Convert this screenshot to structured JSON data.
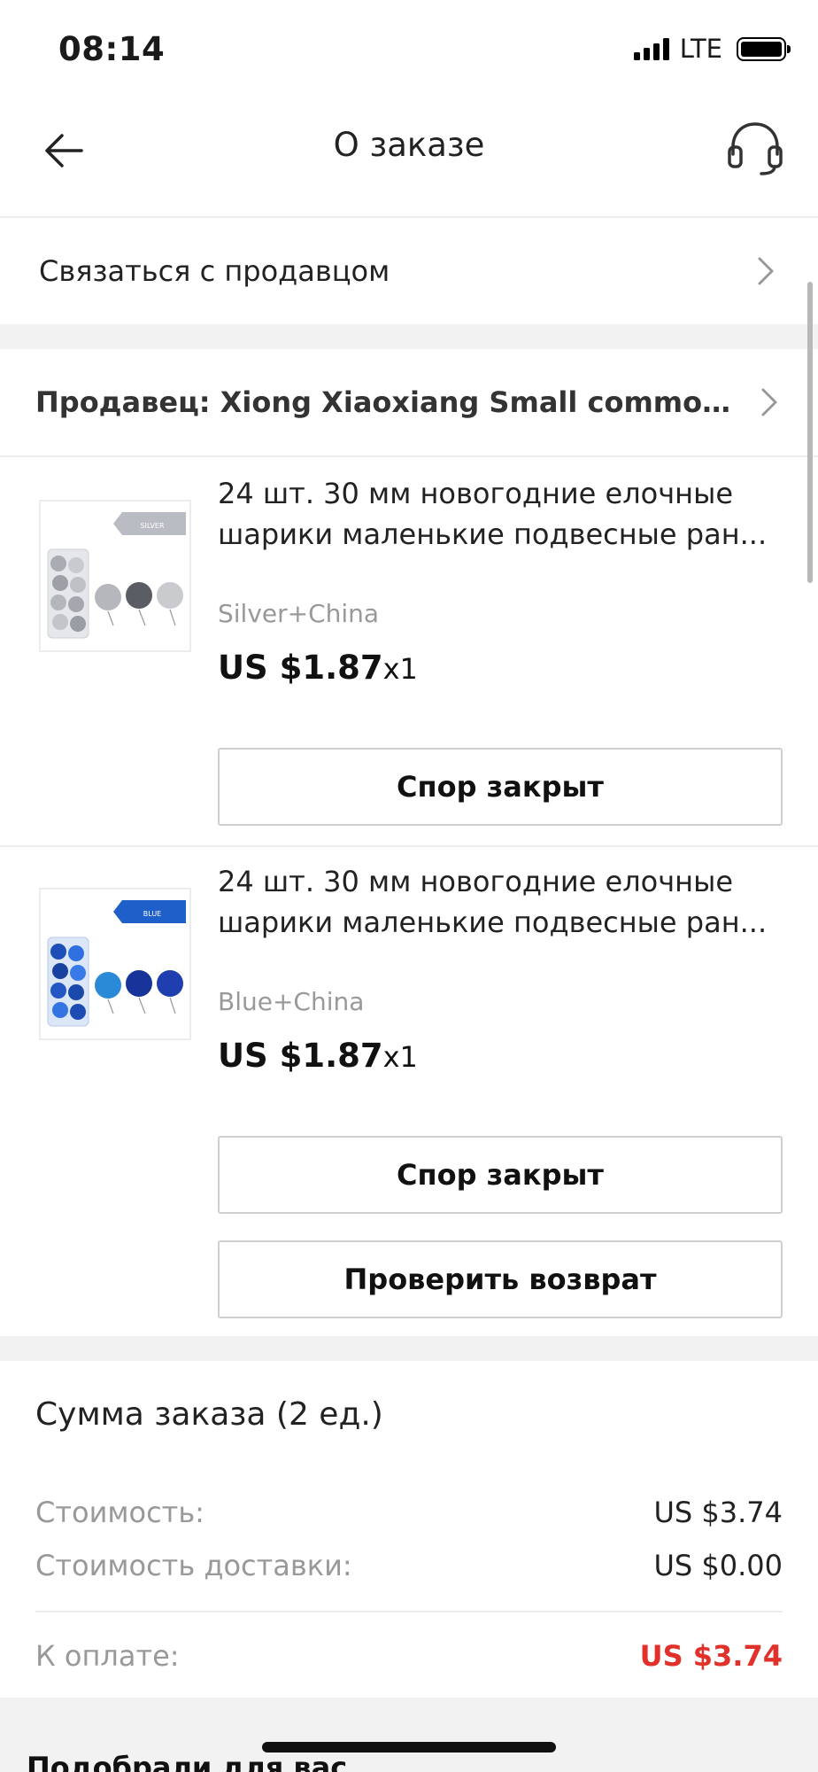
{
  "status_bar": {
    "time": "08:14",
    "network": "LTE"
  },
  "header": {
    "title": "О заказе"
  },
  "contact_seller": {
    "label": "Связаться с продавцом"
  },
  "seller": {
    "label": "Продавец: Xiong Xiaoxiang Small commoditi..."
  },
  "items": [
    {
      "title_line1": "24 шт. 30 мм новогодние елочные",
      "title_line2": "шарики маленькие подвесные ран...",
      "variant": "Silver+China",
      "price": "US $1.87",
      "qty": "x1",
      "thumb_tag": "SILVER",
      "thumb_color": "#b9bcc2",
      "buttons": [
        "Спор закрыт"
      ]
    },
    {
      "title_line1": "24 шт. 30 мм новогодние елочные",
      "title_line2": "шарики маленькие подвесные ран...",
      "variant": "Blue+China",
      "price": "US $1.87",
      "qty": "x1",
      "thumb_tag": "BLUE",
      "thumb_color": "#1f5fc9",
      "buttons": [
        "Спор закрыт",
        "Проверить возврат"
      ]
    }
  ],
  "summary": {
    "title": "Сумма заказа (2 ед.)",
    "cost_label": "Стоимость:",
    "cost_value": "US $3.74",
    "shipping_label": "Стоимость доставки:",
    "shipping_value": "US $0.00",
    "total_label": "К оплате:",
    "total_value": "US $3.74"
  },
  "recommend": {
    "title": "Подобрали для вас"
  },
  "colors": {
    "accent_red": "#e0322b",
    "muted": "#999999",
    "band": "#f2f2f2"
  }
}
